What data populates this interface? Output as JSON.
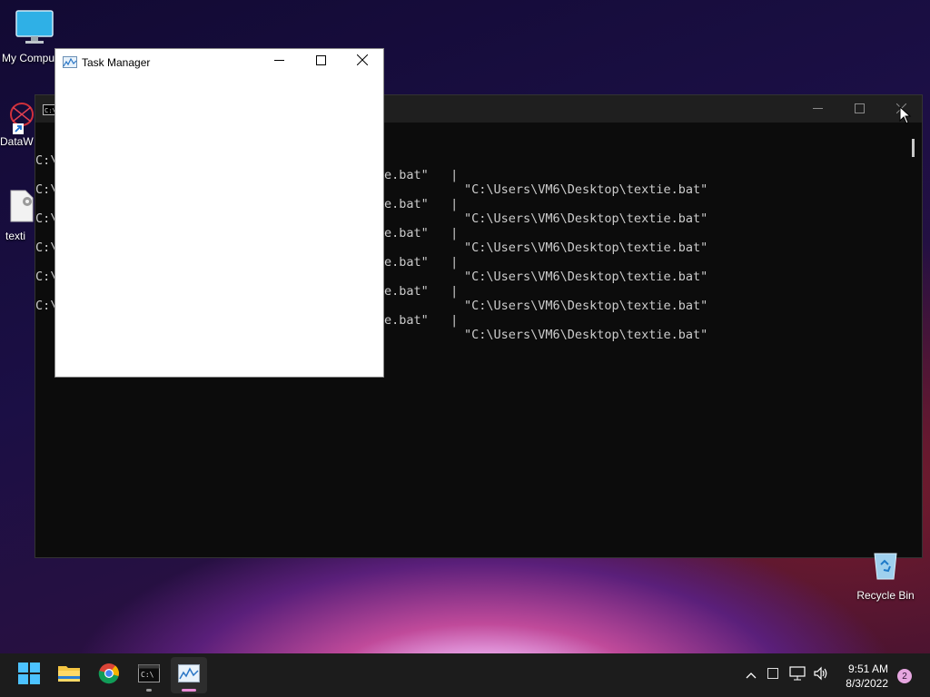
{
  "desktop": {
    "icons": [
      {
        "label": "My Compu"
      },
      {
        "label": "DataW"
      },
      {
        "label": "texti"
      }
    ],
    "recycle_bin": {
      "label": "Recycle Bin"
    }
  },
  "console": {
    "lines": [
      {
        "prefix": "C:\\",
        "mid": "e.bat\"   |",
        "path": "\"C:\\Users\\VM6\\Desktop\\textie.bat\""
      },
      {
        "prefix": "C:\\",
        "mid": "e.bat\"   |",
        "path": "\"C:\\Users\\VM6\\Desktop\\textie.bat\""
      },
      {
        "prefix": "C:\\",
        "mid": "e.bat\"   |",
        "path": "\"C:\\Users\\VM6\\Desktop\\textie.bat\""
      },
      {
        "prefix": "C:\\",
        "mid": "e.bat\"   |",
        "path": "\"C:\\Users\\VM6\\Desktop\\textie.bat\""
      },
      {
        "prefix": "C:\\",
        "mid": "e.bat\"   |",
        "path": "\"C:\\Users\\VM6\\Desktop\\textie.bat\""
      },
      {
        "prefix": "C:\\",
        "mid": "e.bat\"   |",
        "path": "\"C:\\Users\\VM6\\Desktop\\textie.bat\""
      }
    ]
  },
  "task_manager": {
    "title": "Task Manager"
  },
  "taskbar": {
    "apps": [
      {
        "name": "start"
      },
      {
        "name": "file-explorer"
      },
      {
        "name": "chrome"
      },
      {
        "name": "terminal"
      },
      {
        "name": "task-manager"
      }
    ]
  },
  "clock": {
    "time": "9:51 AM",
    "date": "8/3/2022"
  },
  "notifications": {
    "count": "2"
  },
  "colors": {
    "taskbar": "#1c1c1c",
    "console_bg": "#0c0c0c",
    "accent": "#0078d4"
  }
}
